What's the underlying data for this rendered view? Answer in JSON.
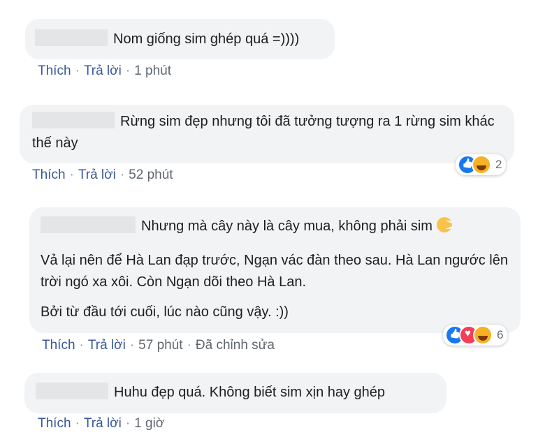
{
  "actions": {
    "like": "Thích",
    "reply": "Trả lời",
    "sep": "·",
    "edited": "Đã chỉnh sửa"
  },
  "comments": [
    {
      "text": "Nom giống sim ghép quá =))))",
      "time": "1 phút"
    },
    {
      "text": "Rừng sim đẹp nhưng tôi đã tưởng tượng ra 1 rừng sim khác thế này",
      "time": "52 phút",
      "reactions": "2",
      "icons": [
        "like-icon",
        "haha-icon"
      ]
    },
    {
      "lines": [
        "Nhưng mà cây này là cây mua, không phải sim",
        "Vả lại nên để Hà Lan đạp trước, Ngạn vác đàn theo sau. Hà Lan ngước lên trời ngó xa xôi. Còn Ngạn dõi theo Hà Lan.",
        "Bởi từ đầu tới cuối, lúc nào cũng vậy. :))"
      ],
      "time": "57 phút",
      "reactions": "6",
      "icons": [
        "like-icon",
        "love-icon",
        "haha-icon"
      ]
    },
    {
      "text": "Huhu đẹp quá. Không biết sim xịn hay ghép",
      "time": "1 giờ"
    }
  ]
}
